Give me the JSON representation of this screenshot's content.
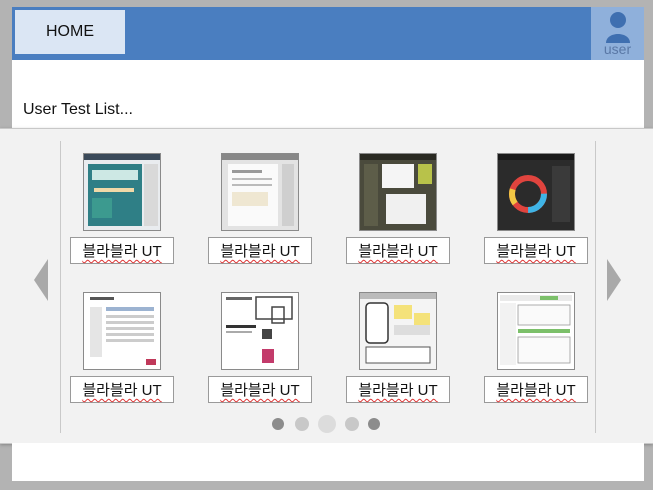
{
  "header": {
    "home_label": "HOME",
    "user_label": "user"
  },
  "main": {
    "list_title": "User Test List..."
  },
  "carousel": {
    "items": [
      {
        "label": "블라블라 UT",
        "thumb": "signup-promo-mockup"
      },
      {
        "label": "블라블라 UT",
        "thumb": "form-page-mockup"
      },
      {
        "label": "블라블라 UT",
        "thumb": "dark-editor-mockup"
      },
      {
        "label": "블라블라 UT",
        "thumb": "color-wheel-mockup"
      },
      {
        "label": "블라블라 UT",
        "thumb": "table-document-mockup"
      },
      {
        "label": "블라블라 UT",
        "thumb": "devices-landing-mockup"
      },
      {
        "label": "블라블라 UT",
        "thumb": "mobile-wireframe-mockup"
      },
      {
        "label": "블라블라 UT",
        "thumb": "admin-dashboard-mockup"
      }
    ],
    "pagination": {
      "pages": 5,
      "current": 3
    },
    "colors": {
      "dot_dark": "#8c8c8c",
      "dot_light": "#c8c8c8",
      "dot_active": "#dcdcdc",
      "arrow": "#a9a9a9"
    }
  },
  "colors": {
    "topbar": "#4a7ec0",
    "home_tab": "#dbe6f4",
    "user_box": "#8fb0db"
  },
  "icons": [
    "user-icon",
    "chevron-left-icon",
    "chevron-right-icon"
  ]
}
